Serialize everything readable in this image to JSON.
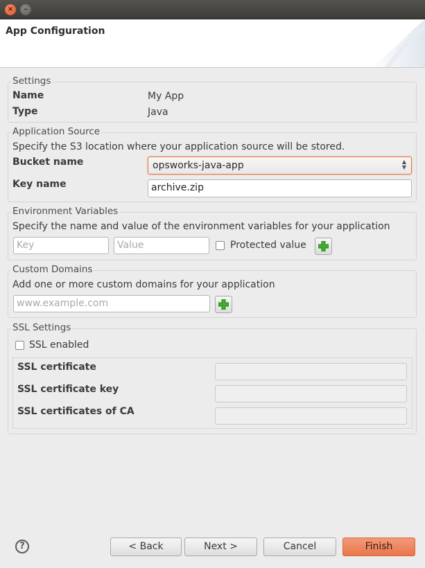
{
  "window": {
    "close_glyph": "×",
    "min_glyph": "–"
  },
  "header": {
    "title": "App Configuration"
  },
  "settings": {
    "legend": "Settings",
    "name_label": "Name",
    "name_value": "My App",
    "type_label": "Type",
    "type_value": "Java"
  },
  "app_source": {
    "legend": "Application Source",
    "description": "Specify the S3 location where your application source will be stored.",
    "bucket_label": "Bucket name",
    "bucket_value": "opsworks-java-app",
    "key_label": "Key name",
    "key_value": "archive.zip"
  },
  "env_vars": {
    "legend": "Environment Variables",
    "description": "Specify the name and value of the environment variables for your application",
    "key_placeholder": "Key",
    "value_placeholder": "Value",
    "protected_label": "Protected value",
    "protected_checked": false
  },
  "custom_domains": {
    "legend": "Custom Domains",
    "description": "Add one or more custom domains for your application",
    "domain_placeholder": "www.example.com"
  },
  "ssl": {
    "legend": "SSL Settings",
    "enabled_label": "SSL enabled",
    "enabled_checked": false,
    "cert_label": "SSL certificate",
    "cert_key_label": "SSL certificate key",
    "ca_label": "SSL certificates of CA"
  },
  "footer": {
    "help_glyph": "?",
    "back_label": "< Back",
    "next_label": "Next >",
    "cancel_label": "Cancel",
    "finish_label": "Finish"
  },
  "colors": {
    "accent": "#e9764c",
    "add_icon": "#3fae2a"
  }
}
